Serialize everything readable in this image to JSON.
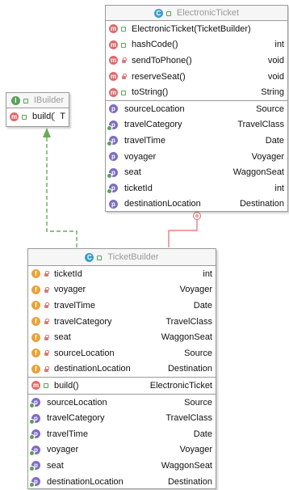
{
  "colors": {
    "realization_arrow": "#6aaa5a",
    "composition_line": "#e06a6a",
    "class_badge": "#3aa0c8",
    "interface_badge": "#5aa05a",
    "method_badge": "#e06a6a",
    "field_badge": "#e8a33a",
    "property_badge": "#7e6cc4"
  },
  "ibuilder": {
    "badge": "I",
    "title": "IBuilder",
    "methods": [
      {
        "badge": "m",
        "name": "build()",
        "type": "T"
      }
    ]
  },
  "electronic_ticket": {
    "badge": "C",
    "title": "ElectronicTicket",
    "methods": [
      {
        "badge": "m",
        "name": "ElectronicTicket(TicketBuilder)",
        "type": ""
      },
      {
        "badge": "m",
        "name": "hashCode()",
        "type": "int"
      },
      {
        "badge": "m",
        "name": "sendToPhone()",
        "type": "void"
      },
      {
        "badge": "m",
        "name": "reserveSeat()",
        "type": "void"
      },
      {
        "badge": "m",
        "name": "toString()",
        "type": "String"
      }
    ],
    "properties": [
      {
        "badge": "p",
        "name": "sourceLocation",
        "type": "Source"
      },
      {
        "badge": "p",
        "name": "travelCategory",
        "type": "TravelClass"
      },
      {
        "badge": "p",
        "name": "travelTime",
        "type": "Date"
      },
      {
        "badge": "p",
        "name": "voyager",
        "type": "Voyager"
      },
      {
        "badge": "p",
        "name": "seat",
        "type": "WaggonSeat"
      },
      {
        "badge": "p",
        "name": "ticketId",
        "type": "int"
      },
      {
        "badge": "p",
        "name": "destinationLocation",
        "type": "Destination"
      }
    ]
  },
  "ticket_builder": {
    "badge": "C",
    "title": "TicketBuilder",
    "fields": [
      {
        "badge": "f",
        "name": "ticketId",
        "type": "int"
      },
      {
        "badge": "f",
        "name": "voyager",
        "type": "Voyager"
      },
      {
        "badge": "f",
        "name": "travelTime",
        "type": "Date"
      },
      {
        "badge": "f",
        "name": "travelCategory",
        "type": "TravelClass"
      },
      {
        "badge": "f",
        "name": "seat",
        "type": "WaggonSeat"
      },
      {
        "badge": "f",
        "name": "sourceLocation",
        "type": "Source"
      },
      {
        "badge": "f",
        "name": "destinationLocation",
        "type": "Destination"
      }
    ],
    "methods": [
      {
        "badge": "m",
        "name": "build()",
        "type": "ElectronicTicket"
      }
    ],
    "properties": [
      {
        "badge": "p",
        "name": "sourceLocation",
        "type": "Source"
      },
      {
        "badge": "p",
        "name": "travelCategory",
        "type": "TravelClass"
      },
      {
        "badge": "p",
        "name": "travelTime",
        "type": "Date"
      },
      {
        "badge": "p",
        "name": "voyager",
        "type": "Voyager"
      },
      {
        "badge": "p",
        "name": "seat",
        "type": "WaggonSeat"
      },
      {
        "badge": "p",
        "name": "destinationLocation",
        "type": "Destination"
      }
    ]
  }
}
